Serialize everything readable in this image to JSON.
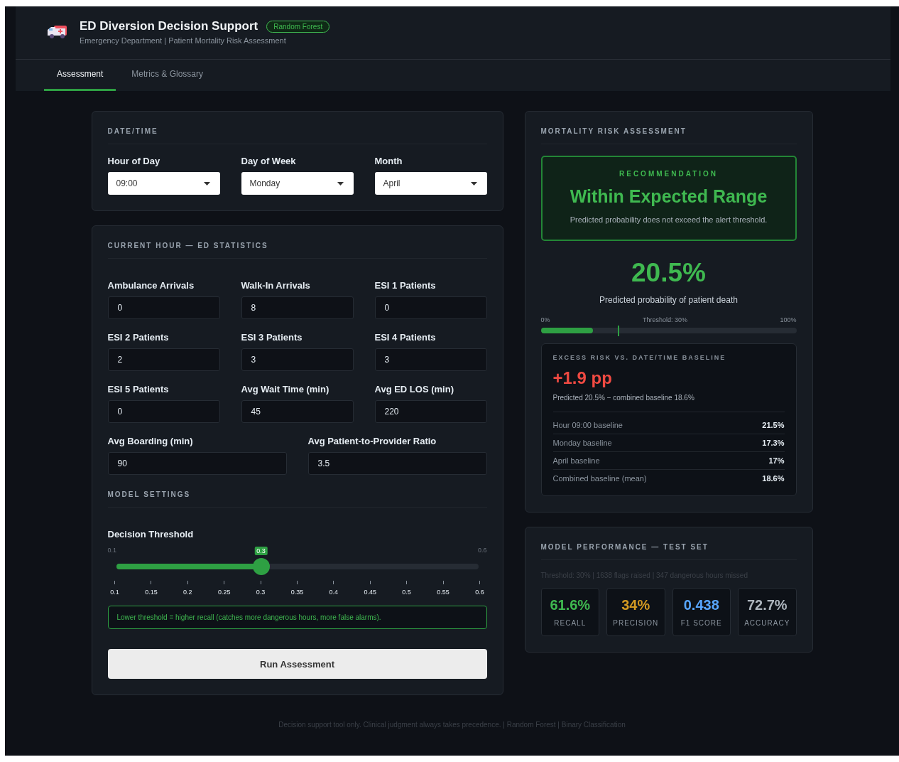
{
  "header": {
    "title": "ED Diversion Decision Support",
    "badge": "Random Forest",
    "subtitle": "Emergency Department | Patient Mortality Risk Assessment"
  },
  "tabs": [
    {
      "label": "Assessment",
      "selected": true
    },
    {
      "label": "Metrics & Glossary",
      "selected": false
    }
  ],
  "datetime": {
    "heading": "DATE/TIME",
    "fields": [
      {
        "label": "Hour of Day",
        "value": "09:00"
      },
      {
        "label": "Day of Week",
        "value": "Monday"
      },
      {
        "label": "Month",
        "value": "April"
      }
    ]
  },
  "statistics": {
    "heading": "CURRENT HOUR — ED STATISTICS",
    "fields": [
      {
        "label": "Ambulance Arrivals",
        "value": "0"
      },
      {
        "label": "Walk-In Arrivals",
        "value": "8"
      },
      {
        "label": "ESI 1 Patients",
        "value": "0"
      },
      {
        "label": "ESI 2 Patients",
        "value": "2"
      },
      {
        "label": "ESI 3 Patients",
        "value": "3"
      },
      {
        "label": "ESI 4 Patients",
        "value": "3"
      },
      {
        "label": "ESI 5 Patients",
        "value": "0"
      },
      {
        "label": "Avg Wait Time (min)",
        "value": "45"
      },
      {
        "label": "Avg ED LOS (min)",
        "value": "220"
      }
    ],
    "wide_fields": [
      {
        "label": "Avg Boarding (min)",
        "value": "90"
      },
      {
        "label": "Avg Patient-to-Provider Ratio",
        "value": "3.5"
      }
    ]
  },
  "model_settings": {
    "heading": "MODEL SETTINGS",
    "slider": {
      "label": "Decision Threshold",
      "min_label": "0.1",
      "max_label": "0.6",
      "value": "0.3",
      "level": 0.4,
      "ticks": [
        "0.1",
        "0.15",
        "0.2",
        "0.25",
        "0.3",
        "0.35",
        "0.4",
        "0.45",
        "0.5",
        "0.55",
        "0.6"
      ]
    },
    "hint": "Lower threshold = higher recall (catches more dangerous hours, more false alarms).",
    "button": "Run Assessment"
  },
  "risk": {
    "heading": "MORTALITY RISK ASSESSMENT",
    "recommendation": {
      "label": "RECOMMENDATION",
      "title": "Within Expected Range",
      "text": "Predicted probability does not exceed the alert threshold."
    },
    "probability": "20.5%",
    "probability_caption": "Predicted probability of patient death",
    "bar": {
      "start_label": "0%",
      "threshold_label": "Threshold: 30%",
      "end_label": "100%",
      "level": 0.205,
      "threshold_marker": {
        "level": 0.3
      }
    },
    "excess": {
      "heading": "EXCESS RISK VS. DATE/TIME BASELINE",
      "value": "+1.9 pp",
      "caption": "Predicted 20.5% − combined baseline 18.6%",
      "rows": [
        {
          "label": "Hour 09:00 baseline",
          "value": "21.5%"
        },
        {
          "label": "Monday baseline",
          "value": "17.3%"
        },
        {
          "label": "April baseline",
          "value": "17%"
        },
        {
          "label": "Combined baseline (mean)",
          "value": "18.6%"
        }
      ]
    }
  },
  "performance": {
    "heading": "MODEL PERFORMANCE — TEST SET",
    "summary": "Threshold: 30% | 1638 flags raised | 347 dangerous hours missed",
    "metrics": [
      {
        "value": "61.6%",
        "label": "RECALL",
        "color": "#3fb950"
      },
      {
        "value": "34%",
        "label": "PRECISION",
        "color": "#d29922"
      },
      {
        "value": "0.438",
        "label": "F1 SCORE",
        "color": "#58a6ff"
      },
      {
        "value": "72.7%",
        "label": "ACCURACY",
        "color": "#adb5bd"
      }
    ]
  },
  "footer": "Decision support tool only. Clinical judgment always takes precedence. | Random Forest | Binary Classification"
}
